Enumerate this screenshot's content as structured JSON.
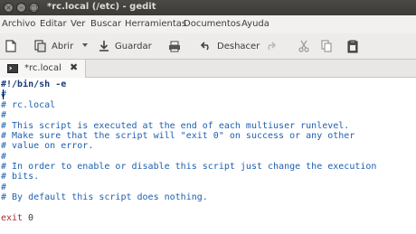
{
  "window": {
    "title": "*rc.local (/etc) - gedit"
  },
  "menu": {
    "items": [
      "Archivo",
      "Editar",
      "Ver",
      "Buscar",
      "Herramientas",
      "Documentos",
      "Ayuda"
    ]
  },
  "toolbar": {
    "open_label": "Abrir",
    "save_label": "Guardar",
    "undo_label": "Deshacer"
  },
  "tabs": [
    {
      "label": "*rc.local"
    }
  ],
  "editor": {
    "lines": [
      "#!/bin/sh -e",
      "#",
      "# rc.local",
      "#",
      "# This script is executed at the end of each multiuser runlevel.",
      "# Make sure that the script will \"exit 0\" on success or any other",
      "# value on error.",
      "#",
      "# In order to enable or disable this script just change the execution",
      "# bits.",
      "#",
      "# By default this script does nothing.",
      "",
      "exit",
      "0"
    ]
  }
}
